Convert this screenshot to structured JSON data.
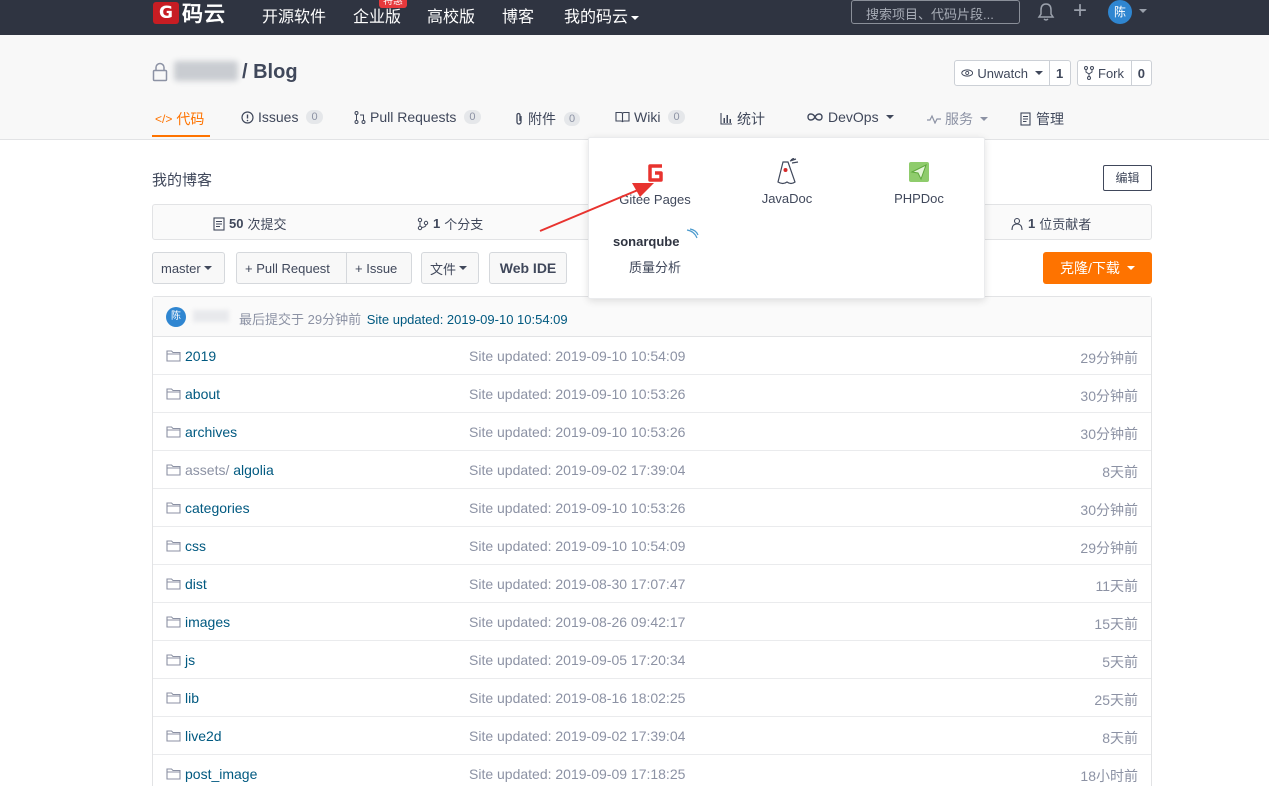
{
  "topnav": {
    "logo_text": "码云",
    "items": [
      "开源软件",
      "企业版",
      "高校版",
      "博客",
      "我的码云"
    ],
    "badge": "特惠",
    "search_placeholder": "搜索项目、代码片段...",
    "avatar_text": "陈"
  },
  "repo": {
    "title": "/ Blog",
    "watch_label": "Unwatch",
    "watch_count": "1",
    "fork_label": "Fork",
    "fork_count": "0"
  },
  "tabs": [
    {
      "label": "代码",
      "count": ""
    },
    {
      "label": "Issues",
      "count": "0"
    },
    {
      "label": "Pull Requests",
      "count": "0"
    },
    {
      "label": "附件",
      "count": "0"
    },
    {
      "label": "Wiki",
      "count": "0"
    },
    {
      "label": "统计",
      "count": ""
    },
    {
      "label": "DevOps",
      "count": ""
    },
    {
      "label": "服务",
      "count": ""
    },
    {
      "label": "管理",
      "count": ""
    }
  ],
  "description": "我的博客",
  "edit_label": "编辑",
  "stats": {
    "commits_num": "50",
    "commits_label": "次提交",
    "branches_num": "1",
    "branches_label": "个分支",
    "contributors_num": "1",
    "contributors_label": "位贡献者"
  },
  "toolbar": {
    "branch": "master",
    "pull_request": "+ Pull Request",
    "issue": "+ Issue",
    "file": "文件",
    "web_ide": "Web IDE",
    "clone": "克隆/下载"
  },
  "last_commit": {
    "avatar": "陈",
    "prefix": "最后提交于 29分钟前",
    "message": "Site updated: 2019-09-10 10:54:09"
  },
  "files": [
    {
      "prefix": "",
      "name": "2019",
      "message": "Site updated: 2019-09-10 10:54:09",
      "time": "29分钟前"
    },
    {
      "prefix": "",
      "name": "about",
      "message": "Site updated: 2019-09-10 10:53:26",
      "time": "30分钟前"
    },
    {
      "prefix": "",
      "name": "archives",
      "message": "Site updated: 2019-09-10 10:53:26",
      "time": "30分钟前"
    },
    {
      "prefix": "assets/ ",
      "name": "algolia",
      "message": "Site updated: 2019-09-02 17:39:04",
      "time": "8天前"
    },
    {
      "prefix": "",
      "name": "categories",
      "message": "Site updated: 2019-09-10 10:53:26",
      "time": "30分钟前"
    },
    {
      "prefix": "",
      "name": "css",
      "message": "Site updated: 2019-09-10 10:54:09",
      "time": "29分钟前"
    },
    {
      "prefix": "",
      "name": "dist",
      "message": "Site updated: 2019-08-30 17:07:47",
      "time": "11天前"
    },
    {
      "prefix": "",
      "name": "images",
      "message": "Site updated: 2019-08-26 09:42:17",
      "time": "15天前"
    },
    {
      "prefix": "",
      "name": "js",
      "message": "Site updated: 2019-09-05 17:20:34",
      "time": "5天前"
    },
    {
      "prefix": "",
      "name": "lib",
      "message": "Site updated: 2019-08-16 18:02:25",
      "time": "25天前"
    },
    {
      "prefix": "",
      "name": "live2d",
      "message": "Site updated: 2019-09-02 17:39:04",
      "time": "8天前"
    },
    {
      "prefix": "",
      "name": "post_image",
      "message": "Site updated: 2019-09-09 17:18:25",
      "time": "18小时前"
    }
  ],
  "services": {
    "gitee_pages": "Gitee Pages",
    "javadoc": "JavaDoc",
    "phpdoc": "PHPDoc",
    "sonar_logo": "sonarqube",
    "quality": "质量分析"
  },
  "colors": {
    "accent": "#fe7300",
    "topbar": "#2f3441",
    "brand_red": "#c71d23",
    "link": "#005980",
    "arrow": "#e8332f"
  }
}
